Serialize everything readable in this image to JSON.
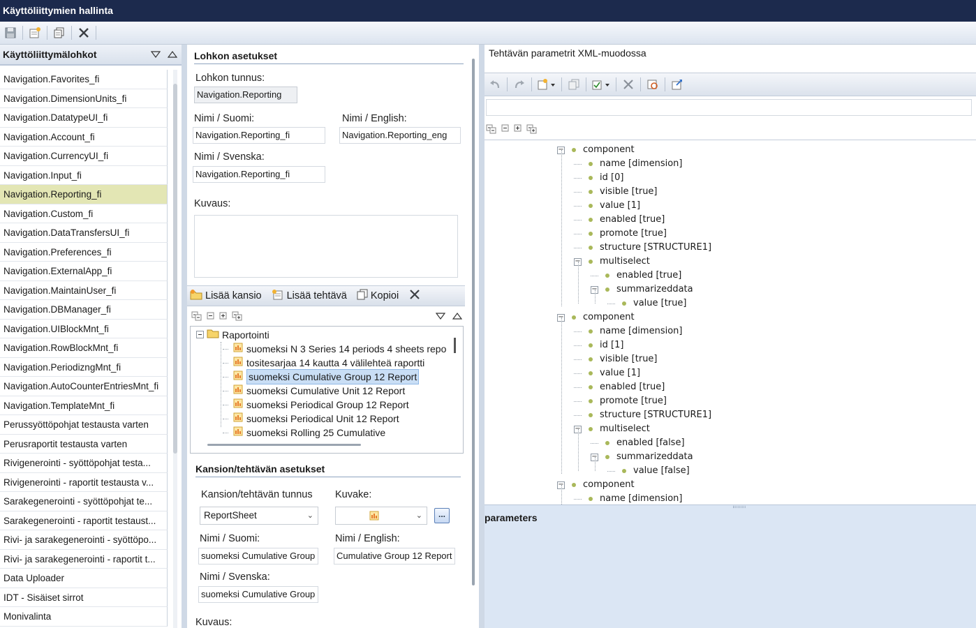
{
  "window": {
    "title": "Käyttöliittymien hallinta"
  },
  "colors": {
    "titlebar": "#1c2a4d",
    "selection": "#e3e6b4",
    "tree_selection": "#c9def5",
    "node_dot": "#a9b85a"
  },
  "toolbar": {
    "icons": [
      "save-icon",
      "new-block-icon",
      "copy-icon",
      "delete-icon"
    ]
  },
  "left_panel": {
    "title": "Käyttöliittymälohkot",
    "items": [
      "Navigation.Favorites_fi",
      "Navigation.DimensionUnits_fi",
      "Navigation.DatatypeUI_fi",
      "Navigation.Account_fi",
      "Navigation.CurrencyUI_fi",
      "Navigation.Input_fi",
      "Navigation.Reporting_fi",
      "Navigation.Custom_fi",
      "Navigation.DataTransfersUI_fi",
      "Navigation.Preferences_fi",
      "Navigation.ExternalApp_fi",
      "Navigation.MaintainUser_fi",
      "Navigation.DBManager_fi",
      "Navigation.UIBlockMnt_fi",
      "Navigation.RowBlockMnt_fi",
      "Navigation.PeriodizngMnt_fi",
      "Navigation.AutoCounterEntriesMnt_fi",
      "Navigation.TemplateMnt_fi",
      "Perussyöttöpohjat testausta varten",
      "Perusraportit testausta varten",
      "Rivigenerointi - syöttöpohjat testa...",
      "Rivigenerointi - raportit testausta v...",
      "Sarakegenerointi - syöttöpohjat te...",
      "Sarakegenerointi - raportit testaust...",
      "Rivi- ja sarakegenerointi - syöttöpo...",
      "Rivi- ja sarakegenerointi - raportit t...",
      "Data Uploader",
      "IDT - Sisäiset sirrot",
      "Monivalinta"
    ],
    "selected_index": 6
  },
  "block_settings": {
    "title": "Lohkon asetukset",
    "id_label": "Lohkon tunnus:",
    "id_value": "Navigation.Reporting",
    "name_fi_label": "Nimi / Suomi:",
    "name_fi_value": "Navigation.Reporting_fi",
    "name_en_label": "Nimi / English:",
    "name_en_value": "Navigation.Reporting_eng",
    "name_sv_label": "Nimi / Svenska:",
    "name_sv_value": "Navigation.Reporting_fi",
    "desc_label": "Kuvaus:"
  },
  "folder_toolbar": {
    "add_folder": "Lisää kansio",
    "add_task": "Lisää tehtävä",
    "copy": "Kopioi"
  },
  "folder_tree": {
    "root": "Raportointi",
    "items": [
      "suomeksi N 3 Series 14 periods 4 sheets repo",
      "tositesarjaa 14 kautta 4 välilehteä raportti",
      "suomeksi Cumulative Group 12 Report",
      "suomeksi Cumulative Unit 12 Report",
      "suomeksi Periodical Group 12 Report",
      "suomeksi Periodical Unit 12 Report",
      "suomeksi Rolling 25 Cumulative"
    ],
    "selected_index": 2
  },
  "task_settings": {
    "title": "Kansion/tehtävän asetukset",
    "id_label": "Kansion/tehtävän tunnus",
    "id_value": "ReportSheet",
    "icon_label": "Kuvake:",
    "ellipsis": "...",
    "name_fi_label": "Nimi / Suomi:",
    "name_fi_value": "suomeksi Cumulative Group",
    "name_en_label": "Nimi / English:",
    "name_en_value": "Cumulative Group 12 Report",
    "name_sv_label": "Nimi / Svenska:",
    "name_sv_value": "suomeksi Cumulative Group",
    "desc_label": "Kuvaus:"
  },
  "xml_panel": {
    "title": "Tehtävän parametrit XML-muodossa",
    "nodes": [
      {
        "text": "component",
        "depth": 0,
        "expander": "minus"
      },
      {
        "text": "name [dimension]",
        "depth": 1
      },
      {
        "text": "id [0]",
        "depth": 1
      },
      {
        "text": "visible [true]",
        "depth": 1
      },
      {
        "text": "value [1]",
        "depth": 1
      },
      {
        "text": "enabled [true]",
        "depth": 1
      },
      {
        "text": "promote [true]",
        "depth": 1
      },
      {
        "text": "structure [STRUCTURE1]",
        "depth": 1
      },
      {
        "text": "multiselect",
        "depth": 1,
        "expander": "minus"
      },
      {
        "text": "enabled [true]",
        "depth": 2
      },
      {
        "text": "summarizeddata",
        "depth": 2,
        "expander": "minus"
      },
      {
        "text": "value [true]",
        "depth": 3
      },
      {
        "text": "component",
        "depth": 0,
        "expander": "minus"
      },
      {
        "text": "name [dimension]",
        "depth": 1
      },
      {
        "text": "id [1]",
        "depth": 1
      },
      {
        "text": "visible [true]",
        "depth": 1
      },
      {
        "text": "value [1]",
        "depth": 1
      },
      {
        "text": "enabled [true]",
        "depth": 1
      },
      {
        "text": "promote [true]",
        "depth": 1
      },
      {
        "text": "structure [STRUCTURE1]",
        "depth": 1
      },
      {
        "text": "multiselect",
        "depth": 1,
        "expander": "minus"
      },
      {
        "text": "enabled [false]",
        "depth": 2
      },
      {
        "text": "summarizeddata",
        "depth": 2,
        "expander": "minus"
      },
      {
        "text": "value [false]",
        "depth": 3
      },
      {
        "text": "component",
        "depth": 0,
        "expander": "minus"
      },
      {
        "text": "name [dimension]",
        "depth": 1
      }
    ],
    "params_label": "parameters"
  }
}
